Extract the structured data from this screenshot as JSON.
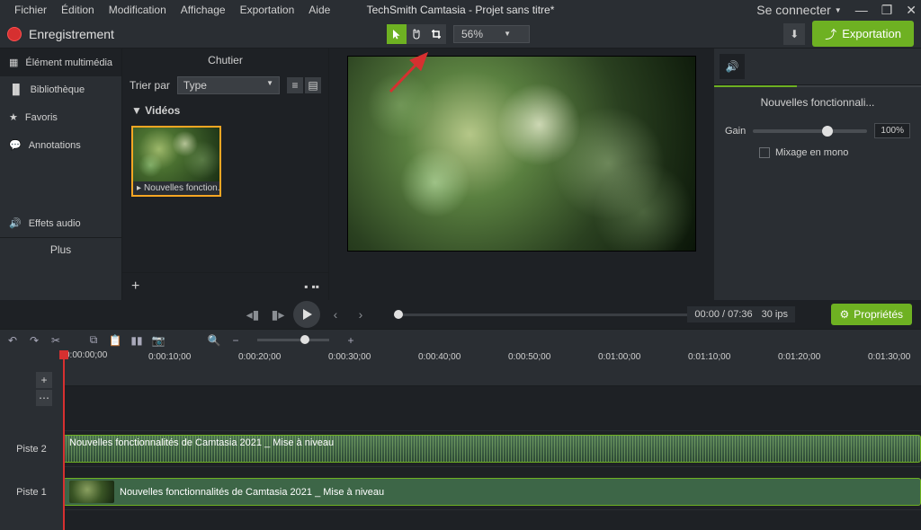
{
  "menubar": {
    "items": [
      "Fichier",
      "Édition",
      "Modification",
      "Affichage",
      "Exportation",
      "Aide"
    ],
    "title": "TechSmith Camtasia - Projet sans titre*",
    "signin": "Se connecter"
  },
  "toolbar": {
    "record": "Enregistrement",
    "zoom": "56%",
    "export": "Exportation"
  },
  "sidebar": {
    "items": [
      {
        "label": "Élément multimédia",
        "icon": "film"
      },
      {
        "label": "Bibliothèque",
        "icon": "book"
      },
      {
        "label": "Favoris",
        "icon": "star"
      },
      {
        "label": "Annotations",
        "icon": "callout"
      },
      {
        "label": "Effets audio",
        "icon": "speaker"
      }
    ],
    "more": "Plus"
  },
  "mediaPanel": {
    "title": "Chutier",
    "sortBy": "Trier par",
    "sortType": "Type",
    "section": "Vidéos",
    "clipLabel": "Nouvelles fonction..."
  },
  "props": {
    "title": "Nouvelles fonctionnali...",
    "gain": "Gain",
    "gainVal": "100%",
    "mono": "Mixage en mono"
  },
  "playback": {
    "time": "00:00 / 07:36",
    "fps": "30 ips",
    "propsBtn": "Propriétés"
  },
  "timeline": {
    "playheadTc": "0:00:00;00",
    "ticks": [
      "0:00:10;00",
      "0:00:20;00",
      "0:00:30;00",
      "0:00:40;00",
      "0:00:50;00",
      "0:01:00;00",
      "0:01:10;00",
      "0:01:20;00",
      "0:01:30;00"
    ],
    "track2": "Piste 2",
    "track1": "Piste 1",
    "clip2": "Nouvelles fonctionnalités de Camtasia 2021 _ Mise à niveau",
    "clip1": "Nouvelles fonctionnalités de Camtasia 2021 _ Mise à niveau"
  }
}
